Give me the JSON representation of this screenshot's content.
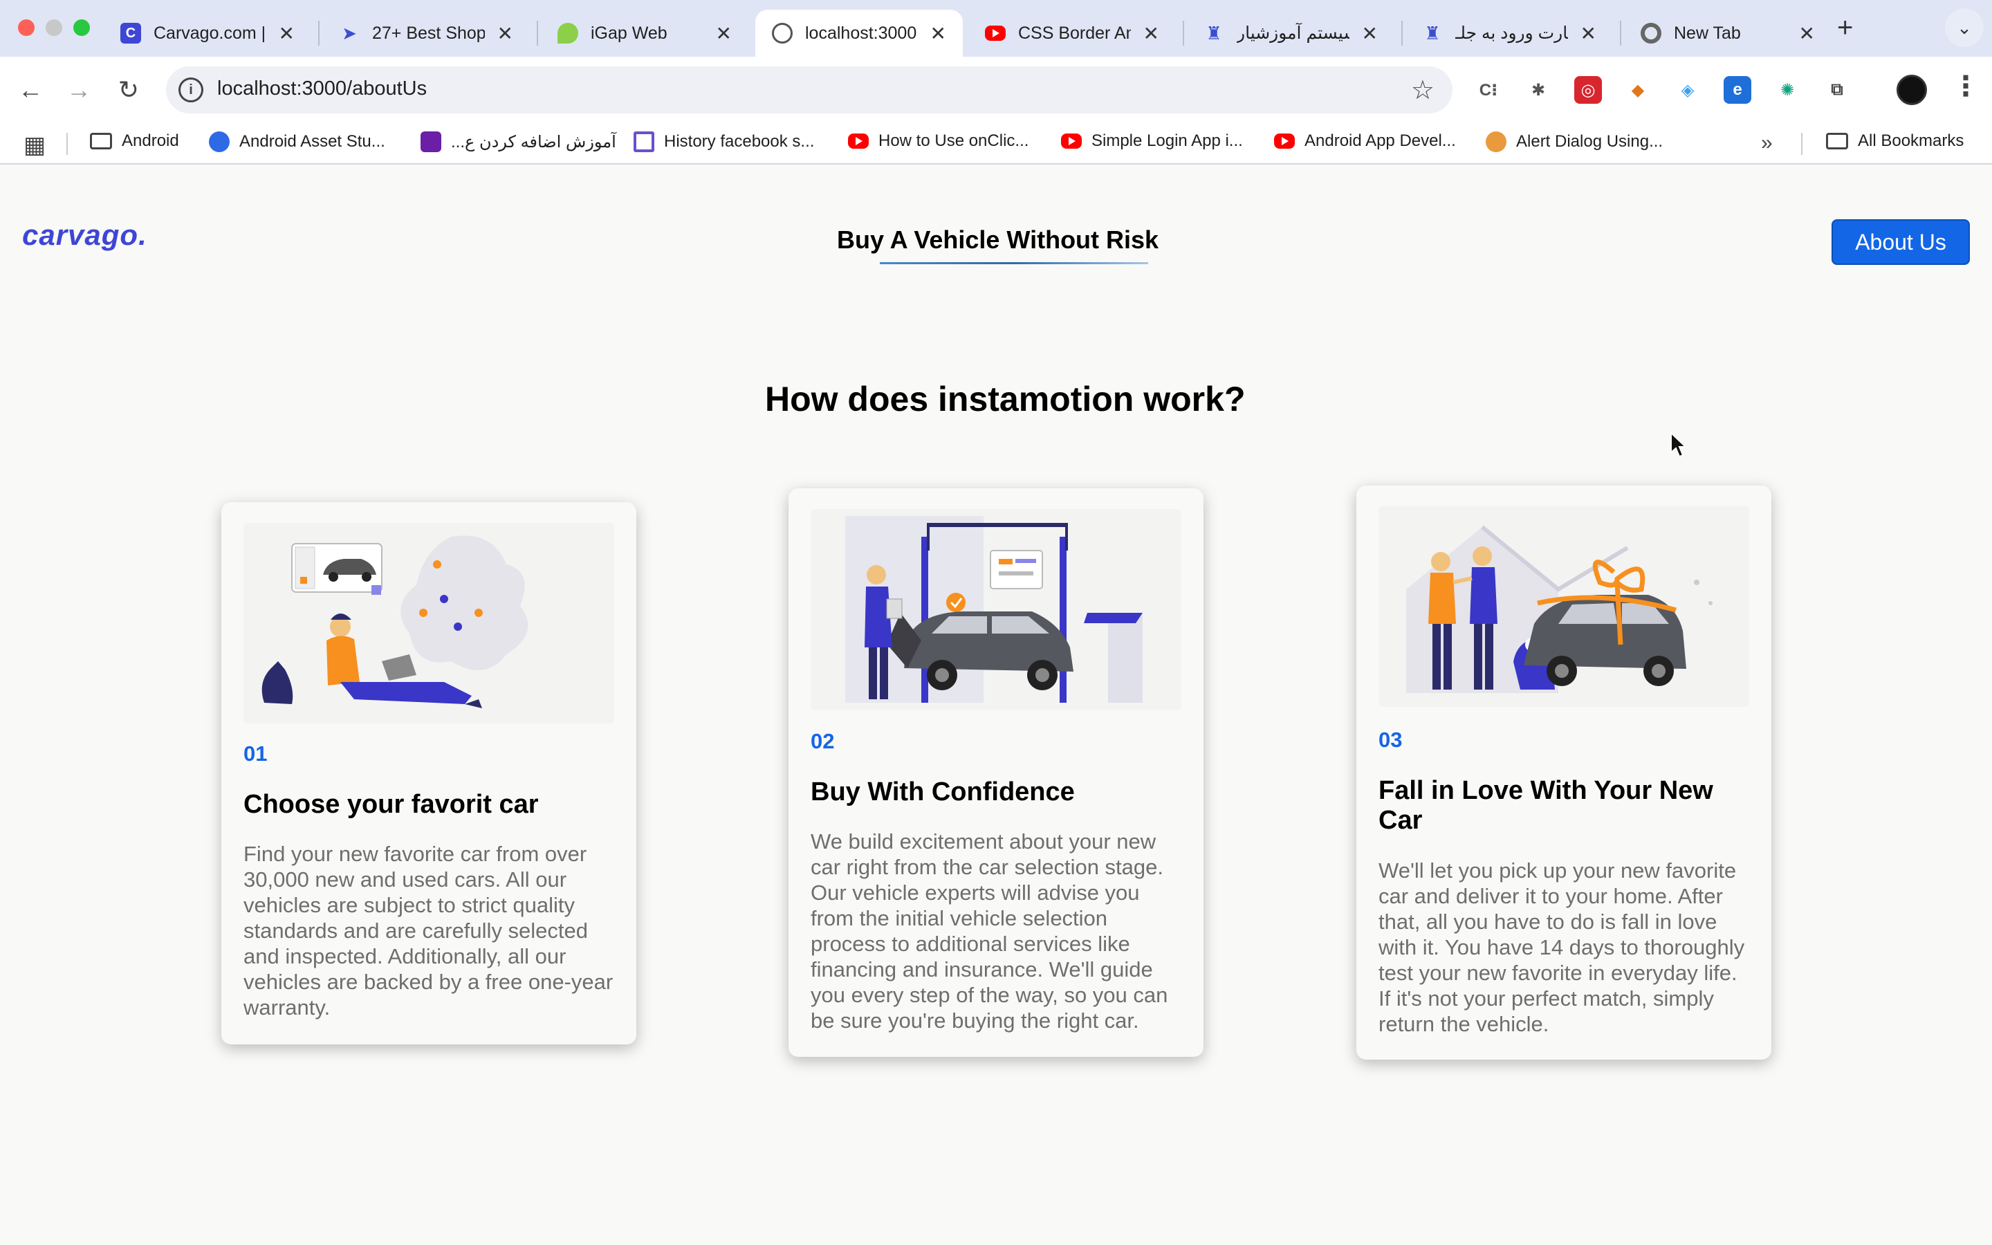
{
  "browser": {
    "tabs": [
      {
        "title": "Carvago.com |",
        "favicon": "carvago-icon"
      },
      {
        "title": "27+ Best Shop",
        "favicon": "paper-plane-icon"
      },
      {
        "title": "iGap Web",
        "favicon": "igap-icon"
      },
      {
        "title": "localhost:3000",
        "favicon": "globe-icon",
        "active": true
      },
      {
        "title": "CSS Border An",
        "favicon": "youtube-icon"
      },
      {
        "title": "سیستم آموزشیار",
        "favicon": "university-icon"
      },
      {
        "title": "کارت ورود به جلـ",
        "favicon": "university-icon"
      },
      {
        "title": "New Tab",
        "favicon": "chrome-icon"
      }
    ],
    "url": "localhost:3000/aboutUs",
    "bookmarks": [
      {
        "label": "Android",
        "icon": "folder-icon"
      },
      {
        "label": "Android Asset Stu...",
        "icon": "compass-icon"
      },
      {
        "label": "...آموزش اضافه کردن ع",
        "icon": "dv-icon"
      },
      {
        "label": "History facebook s...",
        "icon": "f-icon"
      },
      {
        "label": "How to Use onClic...",
        "icon": "youtube-icon"
      },
      {
        "label": "Simple Login App i...",
        "icon": "youtube-icon"
      },
      {
        "label": "Android App Devel...",
        "icon": "youtube-icon"
      },
      {
        "label": "Alert Dialog Using...",
        "icon": "cat-icon"
      },
      {
        "label": "All Bookmarks",
        "icon": "folder-icon"
      }
    ]
  },
  "page": {
    "logo": "carvago.",
    "nav_link": "Buy A Vehicle Without Risk",
    "about_button": "About Us",
    "section_title": "How does instamotion work?",
    "cards": [
      {
        "number": "01",
        "title": "Choose your favorit car",
        "description": "Find your new favorite car from over 30,000 new and used cars. All our vehicles are subject to strict quality standards and are carefully selected and inspected. Additionally, all our vehicles are backed by a free one-year warranty."
      },
      {
        "number": "02",
        "title": "Buy With Confidence",
        "description": "We build excitement about your new car right from the car selection stage. Our vehicle experts will advise you from the initial vehicle selection process to additional services like financing and insurance. We'll guide you every step of the way, so you can be sure you're buying the right car."
      },
      {
        "number": "03",
        "title": "Fall in Love With Your New Car",
        "description": "We'll let you pick up your new favorite car and deliver it to your home. After that, all you have to do is fall in love with it. You have 14 days to thoroughly test your new favorite in everyday life. If it's not your perfect match, simply return the vehicle."
      }
    ]
  },
  "colors": {
    "brand": "#3e46d6",
    "accent": "#1366e6",
    "background": "#f9f9f7",
    "illustration_purple": "#3a36c8",
    "illustration_orange": "#f7901e"
  }
}
